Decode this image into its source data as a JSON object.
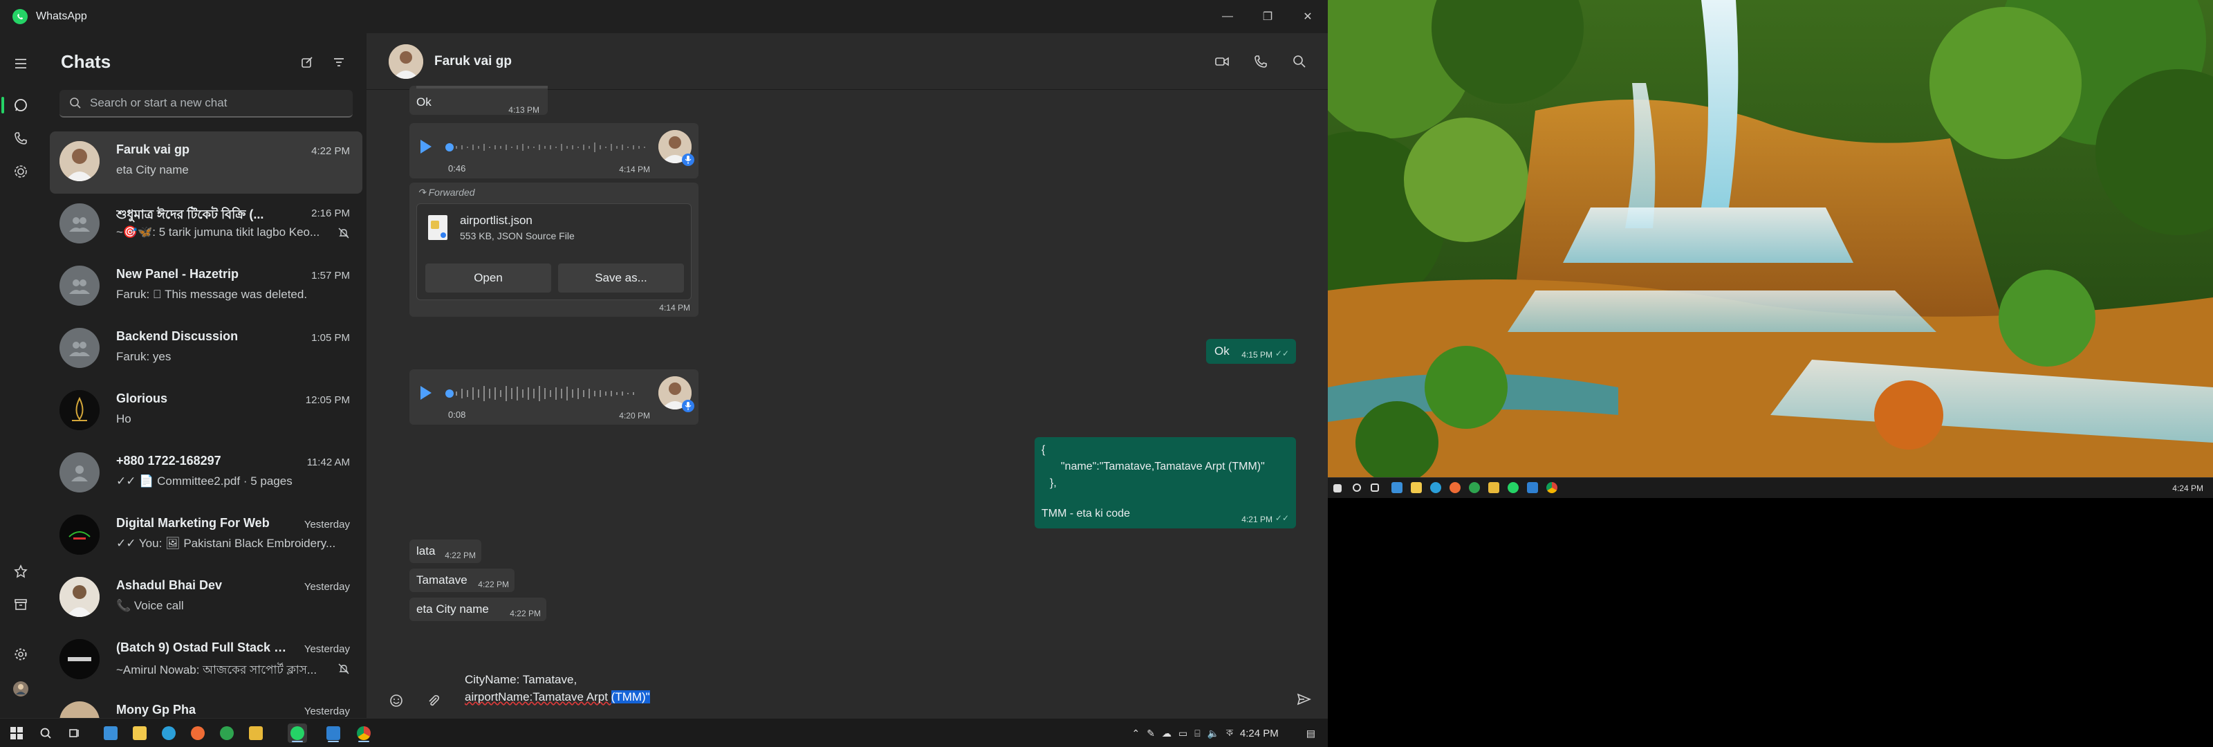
{
  "window": {
    "title": "WhatsApp"
  },
  "sidebar": {
    "title": "Chats",
    "search_placeholder": "Search or start a new chat",
    "chats": [
      {
        "name": "Faruk vai gp",
        "time": "4:22 PM",
        "preview": "eta City name",
        "selected": true
      },
      {
        "name": "শুধুমাত্র ঈদের টিকেট বিক্রি (...",
        "time": "2:16 PM",
        "preview": "~🎯🦋: 5 tarik jumuna tikit lagbo  Keo...",
        "muted": true
      },
      {
        "name": "New Panel - Hazetrip",
        "time": "1:57 PM",
        "preview": "Faruk: ⃠ This message was deleted."
      },
      {
        "name": "Backend Discussion",
        "time": "1:05 PM",
        "preview": "Faruk: yes"
      },
      {
        "name": "Glorious",
        "time": "12:05 PM",
        "preview": "Ho"
      },
      {
        "name": "+880 1722-168297",
        "time": "11:42 AM",
        "preview": "✓✓ 📄 Committee2.pdf · 5 pages"
      },
      {
        "name": "Digital Marketing For Web",
        "time": "Yesterday",
        "preview": "✓✓ You: 🖼 Pakistani Black Embroidery..."
      },
      {
        "name": "Ashadul Bhai Dev",
        "time": "Yesterday",
        "preview": "📞 Voice call"
      },
      {
        "name": "(Batch 9) Ostad Full Stack We...",
        "time": "Yesterday",
        "preview": "~Amirul Nowab: আজকের সাপোর্ট ক্লাস...",
        "muted": true
      },
      {
        "name": "Mony Gp Pha",
        "time": "Yesterday",
        "preview": ""
      }
    ]
  },
  "conversation": {
    "name": "Faruk vai gp",
    "messages": {
      "ok_top": {
        "text": "Ok",
        "time": "4:13 PM"
      },
      "voice1": {
        "duration": "0:46",
        "time": "4:14 PM"
      },
      "forwarded_label": "Forwarded",
      "file": {
        "name": "airportlist.json",
        "meta": "553 KB, JSON Source File",
        "open_label": "Open",
        "save_label": "Save as...",
        "time": "4:14 PM"
      },
      "ok_out": {
        "text": "Ok",
        "time": "4:15 PM"
      },
      "voice2": {
        "duration": "0:08",
        "time": "4:20 PM"
      },
      "json_out": {
        "line1": "{",
        "line2": "\"name\":\"Tamatave,Tamatave Arpt (TMM)\"",
        "line3": "},",
        "line4": "TMM - eta ki code",
        "time": "4:21 PM"
      },
      "lata": {
        "text": "lata",
        "time": "4:22 PM"
      },
      "tamatave": {
        "text": "Tamatave",
        "time": "4:22 PM"
      },
      "city": {
        "text": "eta City name",
        "time": "4:22 PM"
      }
    },
    "draft": {
      "line1": "CityName: Tamatave,",
      "line2_a": "airportName:Tamatave Arpt ",
      "line2_b": "(TMM)\""
    }
  },
  "taskbar": {
    "time": "4:24 PM"
  },
  "second_screen": {
    "time": "4:24 PM"
  }
}
